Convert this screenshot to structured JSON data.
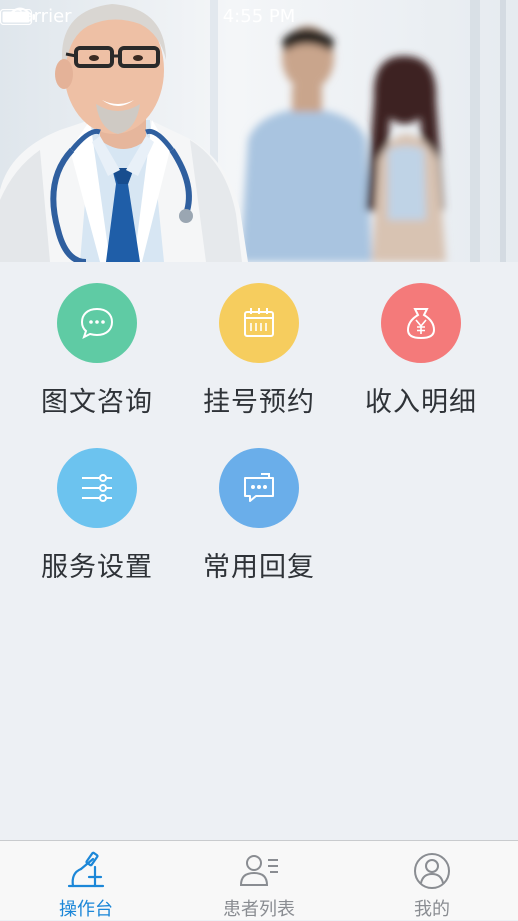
{
  "status_bar": {
    "carrier": "Carrier",
    "time": "4:55 PM"
  },
  "actions": [
    {
      "label": "图文咨询",
      "icon": "chat-bubble-icon",
      "color": "#5fcba4"
    },
    {
      "label": "挂号预约",
      "icon": "calendar-icon",
      "color": "#f6cd5e"
    },
    {
      "label": "收入明细",
      "icon": "money-bag-icon",
      "color": "#f47a7a"
    },
    {
      "label": "服务设置",
      "icon": "settings-list-icon",
      "color": "#6cc3ef"
    },
    {
      "label": "常用回复",
      "icon": "quick-reply-icon",
      "color": "#6aaeea"
    }
  ],
  "tab_bar": {
    "tabs": [
      {
        "label": "操作台",
        "icon": "microscope-icon",
        "active": true
      },
      {
        "label": "患者列表",
        "icon": "patient-list-icon",
        "active": false
      },
      {
        "label": "我的",
        "icon": "profile-icon",
        "active": false
      }
    ]
  },
  "colors": {
    "accent": "#1c87d8",
    "background": "#edf0f4",
    "tab_inactive": "#8a8d92"
  }
}
